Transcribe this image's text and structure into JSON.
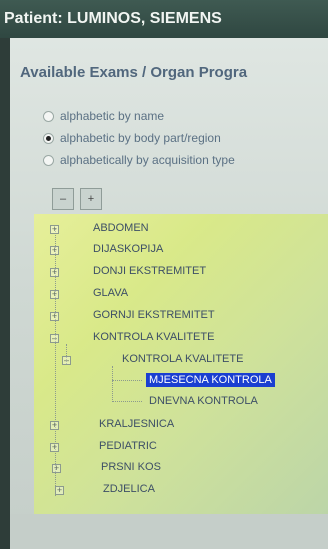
{
  "window": {
    "title": "Patient: LUMINOS, SIEMENS"
  },
  "section": {
    "title": "Available Exams / Organ Progra"
  },
  "sort_options": [
    {
      "label": "alphabetic by name",
      "selected": false
    },
    {
      "label": "alphabetic by body part/region",
      "selected": true
    },
    {
      "label": "alphabetically by acquisition type",
      "selected": false
    }
  ],
  "toolbar": {
    "collapse_glyph": "–",
    "expand_glyph": "+"
  },
  "tree": {
    "items": [
      {
        "label": "ABDOMEN",
        "expander": "+"
      },
      {
        "label": "DIJASKOPIJA",
        "expander": "+"
      },
      {
        "label": "DONJI EKSTREMITET",
        "expander": "+"
      },
      {
        "label": "GLAVA",
        "expander": "+"
      },
      {
        "label": "GORNJI EKSTREMITET",
        "expander": "+"
      },
      {
        "label": "KONTROLA KVALITETE",
        "expander": "–"
      },
      {
        "label": "KONTROLA KVALITETE",
        "expander": "–"
      },
      {
        "label": "MJESECNA KONTROLA",
        "selected": true
      },
      {
        "label": "DNEVNA KONTROLA"
      },
      {
        "label": "KRALJESNICA",
        "expander": "+"
      },
      {
        "label": "PEDIATRIC",
        "expander": "+"
      },
      {
        "label": "PRSNI KOS",
        "expander": "+"
      },
      {
        "label": "ZDJELICA",
        "expander": "+"
      }
    ]
  },
  "colors": {
    "titlebar": "#2f4741",
    "section_title": "#51677d",
    "selection": "#1a3fd1",
    "tree_background": "#d9e989"
  }
}
